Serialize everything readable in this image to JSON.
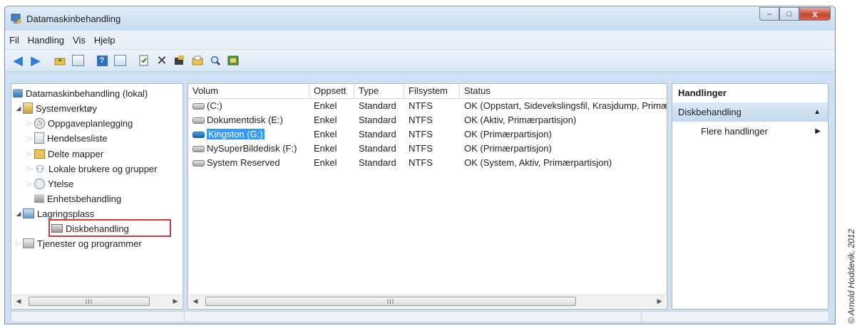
{
  "window": {
    "title": "Datamaskinbehandling",
    "controls": {
      "minimize": "–",
      "maximize": "□",
      "close": "x"
    }
  },
  "menu": [
    "Fil",
    "Handling",
    "Vis",
    "Hjelp"
  ],
  "toolbar": [
    "back-icon",
    "forward-icon",
    "up-folder-icon",
    "console-tree-icon",
    "help-icon",
    "show-hide-pane-icon",
    "properties-icon",
    "delete-icon",
    "refresh-icon",
    "open-icon",
    "search-icon",
    "export-icon"
  ],
  "tree": {
    "root": "Datamaskinbehandling (lokal)",
    "items": [
      {
        "label": "Systemverktøy"
      },
      {
        "label": "Oppgaveplanlegging"
      },
      {
        "label": "Hendelsesliste"
      },
      {
        "label": "Delte mapper"
      },
      {
        "label": "Lokale brukere og grupper"
      },
      {
        "label": "Ytelse"
      },
      {
        "label": "Enhetsbehandling"
      },
      {
        "label": "Lagringsplass"
      },
      {
        "label": "Diskbehandling"
      },
      {
        "label": "Tjenester og programmer"
      }
    ],
    "scroll_label": "III"
  },
  "volumes": {
    "columns": [
      "Volum",
      "Oppsett",
      "Type",
      "Filsystem",
      "Status"
    ],
    "rows": [
      {
        "volume": "(C:)",
        "layout": "Enkel",
        "type": "Standard",
        "fs": "NTFS",
        "status": "OK (Oppstart, Sidevekslingsfil, Krasjdump, Primærpartisjon)"
      },
      {
        "volume": "Dokumentdisk (E:)",
        "layout": "Enkel",
        "type": "Standard",
        "fs": "NTFS",
        "status": "OK (Aktiv, Primærpartisjon)"
      },
      {
        "volume": "Kingston (G:)",
        "layout": "Enkel",
        "type": "Standard",
        "fs": "NTFS",
        "status": "OK (Primærpartisjon)"
      },
      {
        "volume": "NySuperBildedisk (F:)",
        "layout": "Enkel",
        "type": "Standard",
        "fs": "NTFS",
        "status": "OK (Primærpartisjon)"
      },
      {
        "volume": "System Reserved",
        "layout": "Enkel",
        "type": "Standard",
        "fs": "NTFS",
        "status": "OK (System, Aktiv, Primærpartisjon)"
      }
    ],
    "scroll_label": "III"
  },
  "actions": {
    "header": "Handlinger",
    "section": "Diskbehandling",
    "item": "Flere handlinger"
  },
  "copyright": "© Arnold Hoddevik, 2012"
}
